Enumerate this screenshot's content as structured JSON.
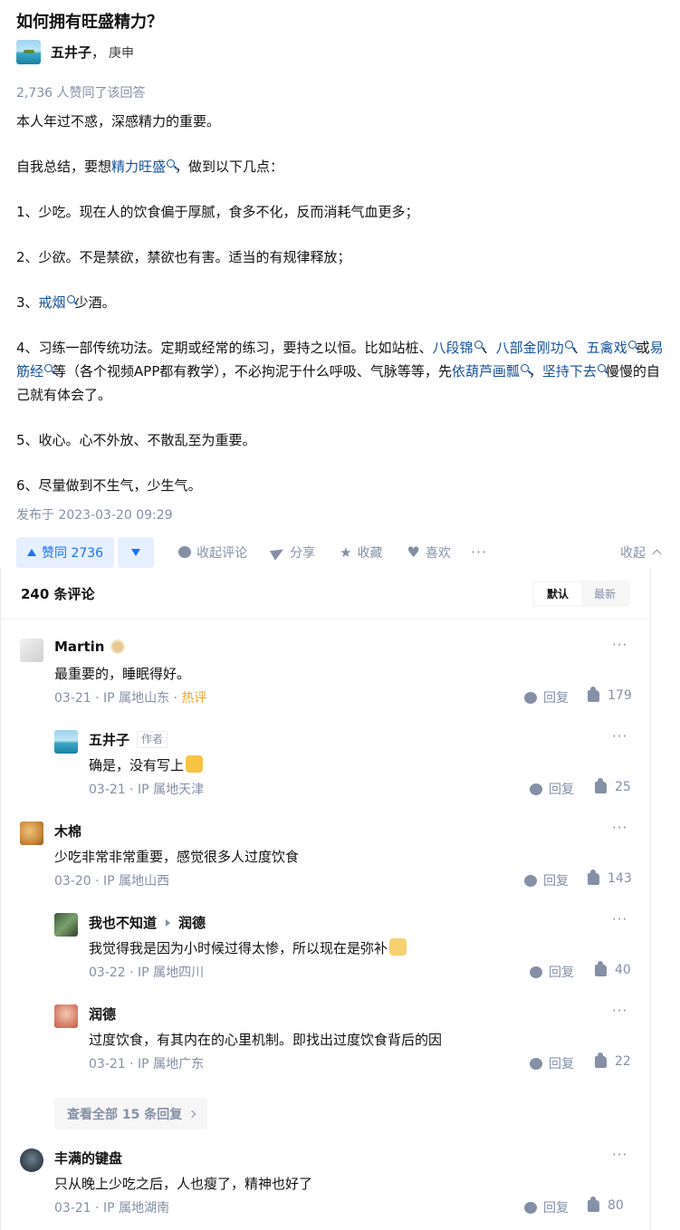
{
  "question": {
    "title": "如何拥有旺盛精力？"
  },
  "author": {
    "name": "五井子",
    "separator": "，",
    "bio": "庚申"
  },
  "vote_summary": "2,736 人赞同了该回答",
  "content": {
    "p1": "本人年过不惑，深感精力的重要。",
    "p2_a": "自我总结，要想",
    "p2_kw": "精力旺盛",
    "p2_b": "，做到以下几点：",
    "p3": "1、少吃。现在人的饮食偏于厚腻，食多不化，反而消耗气血更多；",
    "p4": "2、少欲。不是禁欲，禁欲也有害。适当的有规律释放；",
    "p5_a": "3、",
    "p5_kw": "戒烟",
    "p5_b": "少酒。",
    "p6_a": "4、习练一部传统功法。定期或经常的练习，要持之以恒。比如站桩、",
    "p6_kw1": "八段锦",
    "p6_b": "、",
    "p6_kw2": "八部金刚功",
    "p6_c": "、",
    "p6_kw3": "五禽戏",
    "p6_d": "或",
    "p6_kw4": "易筋经",
    "p6_e": "等（各个视频APP都有教学），不必拘泥于什么呼吸、气脉等等，先",
    "p6_kw5": "依葫芦画瓢",
    "p6_f": "，",
    "p6_kw6": "坚持下去",
    "p6_g": "慢慢的自己就有体会了。",
    "p7": "5、收心。心不外放、不散乱至为重要。",
    "p8": "6、尽量做到不生气，少生气。"
  },
  "publish_time": "发布于 2023-03-20 09:29",
  "actions": {
    "vote_up": "赞同 2736",
    "collapse_comments": "收起评论",
    "share": "分享",
    "favorite": "收藏",
    "like": "喜欢",
    "more": "···",
    "collapse": "收起"
  },
  "comments": {
    "count": "240 条评论",
    "sort_default": "默认",
    "sort_latest": "最新",
    "reply_label": "回复",
    "more": "···",
    "items": [
      {
        "name": "Martin",
        "text": "最重要的，睡眠得好。",
        "date": "03-21",
        "ip": "IP 属地山东",
        "hot": "热评",
        "likes": "179"
      },
      {
        "name": "五井子",
        "tag": "作者",
        "text": "确是，没有写上",
        "date": "03-21",
        "ip": "IP 属地天津",
        "likes": "25"
      },
      {
        "name": "木棉",
        "text": "少吃非常非常重要，感觉很多人过度饮食",
        "date": "03-20",
        "ip": "IP 属地山西",
        "likes": "143"
      },
      {
        "name": "我也不知道",
        "reply_to": "润德",
        "text": "我觉得我是因为小时候过得太惨，所以现在是弥补",
        "date": "03-22",
        "ip": "IP 属地四川",
        "likes": "40"
      },
      {
        "name": "润德",
        "text": "过度饮食，有其内在的心里机制。即找出过度饮食背后的因",
        "date": "03-21",
        "ip": "IP 属地广东",
        "likes": "22"
      },
      {
        "name": "丰满的键盘",
        "text": "只从晚上少吃之后，人也瘦了，精神也好了",
        "date": "03-21",
        "ip": "IP 属地湖南",
        "likes": "80"
      }
    ],
    "view_all": "查看全部 15 条回复",
    "meta_sep": " · "
  }
}
